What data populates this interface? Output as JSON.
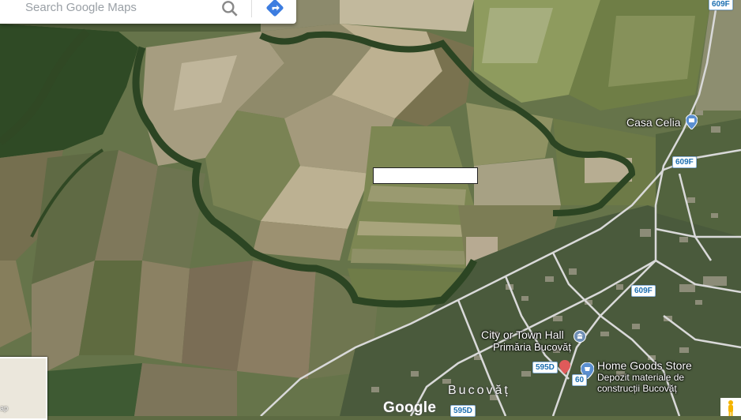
{
  "search": {
    "placeholder": "Search Google Maps"
  },
  "place_labels": {
    "casa_celia": "Casa Celia",
    "city_hall_line1": "City or Town Hall",
    "city_hall_line2": "Primăria Bucovăț",
    "home_goods_line1": "Home Goods Store",
    "home_goods_line2": "Depozit materiale de",
    "home_goods_line3": "construcții Bucovăț",
    "town": "Bucovăț"
  },
  "road_shields": {
    "top_right": "609F",
    "right_upper": "609F",
    "right_lower": "609F",
    "center_595d": "595D",
    "bottom_595d": "595D",
    "bottom_60x": "60"
  },
  "minimap": {
    "label": "ap"
  },
  "branding": {
    "logo": "Google"
  },
  "colors": {
    "road": "#dcdcdc",
    "forest": "#2f4a25",
    "field_light": "#8b8466",
    "field_green": "#6c7d45",
    "poi_blue": "#5b8fd0",
    "shield_text": "#1c6fb1"
  },
  "icons": {
    "search": "search-icon",
    "directions": "directions-icon",
    "landmark": "city-hall-icon",
    "store": "store-icon",
    "lodging": "lodging-icon",
    "pegman": "pegman-icon"
  }
}
